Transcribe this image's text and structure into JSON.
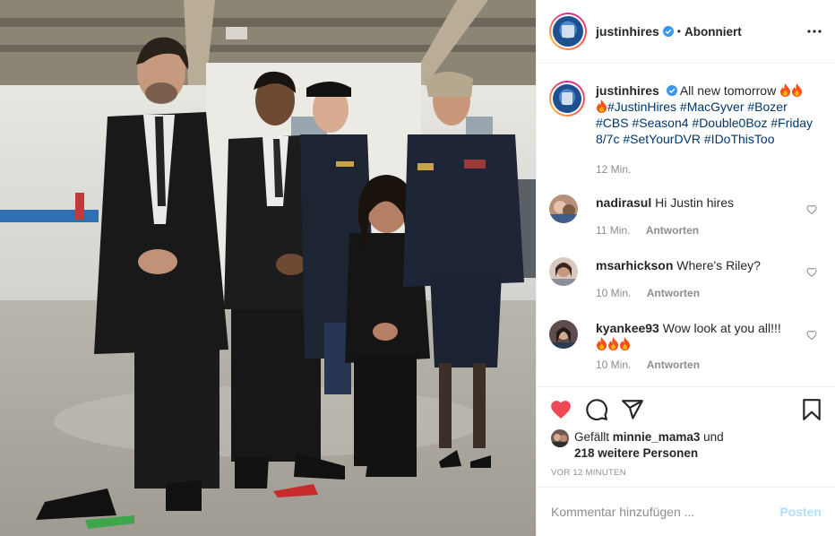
{
  "header": {
    "username": "justinhires",
    "separator": "•",
    "follow_status": "Abonniert"
  },
  "caption": {
    "username": "justinhires",
    "text_start": "All new tomorrow",
    "hashtags_line1": "#JustinHires #MacGyver #Bozer",
    "hashtags_line2": "#CBS #Season4 #Double0Boz #Friday",
    "hashtags_line3": "8/7c #SetYourDVR #IDoThisToo",
    "time": "12 Min."
  },
  "comments": [
    {
      "username": "nadirasul",
      "text": "Hi Justin hires",
      "time": "11 Min.",
      "reply": "Antworten"
    },
    {
      "username": "msarhickson",
      "text": "Where's Riley?",
      "time": "10 Min.",
      "reply": "Antworten"
    },
    {
      "username": "kyankee93",
      "text": "Wow look at you all!!!",
      "time": "10 Min.",
      "reply": "Antworten"
    }
  ],
  "likes": {
    "prefix": "Gefällt",
    "user": "minnie_mama3",
    "conj": "und",
    "others": "218 weitere Personen"
  },
  "post_age": "VOR 12 MINUTEN",
  "composer": {
    "placeholder": "Kommentar hinzufügen ...",
    "post_label": "Posten"
  },
  "icons": {
    "like": "heart-filled-icon",
    "comment": "comment-icon",
    "share": "share-icon",
    "save": "bookmark-icon",
    "more": "more-options-icon",
    "verified": "verified-badge-icon"
  },
  "colors": {
    "like_red": "#ed4956",
    "hashtag_blue": "#00376b",
    "verified_blue": "#3897f0",
    "muted_text": "#8e8e8e",
    "post_button_disabled": "#b2dffc"
  }
}
